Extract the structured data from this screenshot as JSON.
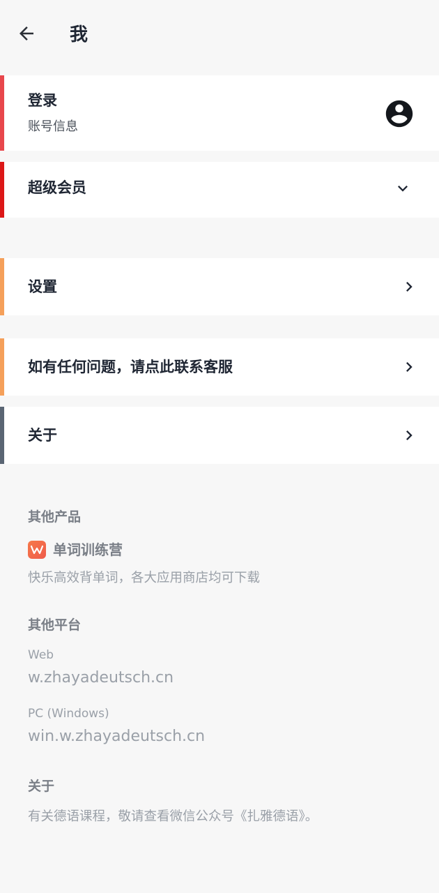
{
  "header": {
    "title": "我"
  },
  "login_card": {
    "title": "登录",
    "subtitle": "账号信息",
    "accent": "#e8474c"
  },
  "vip_card": {
    "title": "超级会员",
    "accent": "#dc1717"
  },
  "settings_card": {
    "title": "设置",
    "accent": "#f5a05a"
  },
  "support_card": {
    "title": "如有任何问题，请点此联系客服",
    "accent": "#f5a05a"
  },
  "about_card": {
    "title": "关于",
    "accent": "#5a6573"
  },
  "other_products": {
    "heading": "其他产品",
    "product_name": "单词训练营",
    "product_desc": "快乐高效背单词，各大应用商店均可下载",
    "logo_color": "#f26b4a"
  },
  "other_platforms": {
    "heading": "其他平台",
    "web_label": "Web",
    "web_link": "w.zhayadeutsch.cn",
    "pc_label": "PC (Windows)",
    "pc_link": "win.w.zhayadeutsch.cn"
  },
  "about_section": {
    "heading": "关于",
    "text": "有关德语课程，敬请查看微信公众号《扎雅德语》。"
  }
}
